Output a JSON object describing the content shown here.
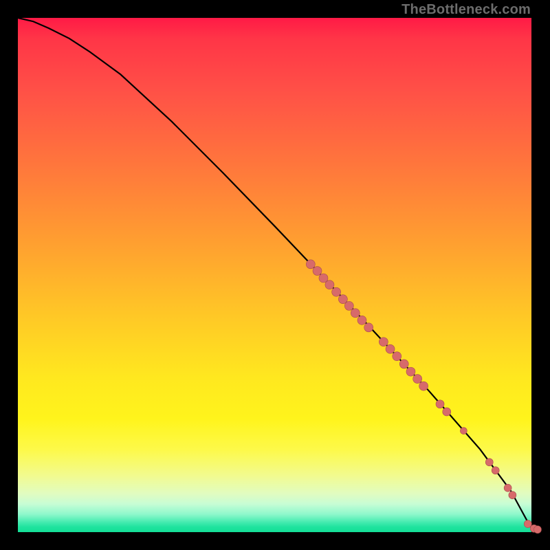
{
  "watermark": "TheBottleneck.com",
  "colors": {
    "background": "#000000",
    "curve": "#000000",
    "points": "#d76a6a",
    "points_stroke": "#a84d4d"
  },
  "chart_data": {
    "type": "scatter",
    "title": "",
    "xlabel": "",
    "ylabel": "",
    "xlim": [
      0,
      100
    ],
    "ylim": [
      0,
      100
    ],
    "curve": {
      "x": [
        0,
        3,
        6,
        10,
        14,
        20,
        30,
        40,
        50,
        60,
        70,
        80,
        90,
        96,
        99,
        100
      ],
      "y": [
        100,
        99.3,
        98.0,
        96.0,
        93.4,
        89.0,
        79.8,
        69.8,
        59.5,
        49.0,
        38.3,
        27.5,
        16.1,
        8.0,
        2.5,
        0.8
      ]
    },
    "series": [
      {
        "name": "cluster-segment",
        "x": [
          57.0,
          58.3,
          59.5,
          60.7,
          62.0,
          63.3,
          64.5,
          65.7,
          67.0,
          68.3
        ],
        "y": [
          52.1,
          50.8,
          49.4,
          48.1,
          46.7,
          45.3,
          44.0,
          42.6,
          41.2,
          39.8
        ],
        "r": 6.5
      },
      {
        "name": "cluster-mid-a",
        "x": [
          71.2,
          72.5,
          73.8
        ],
        "y": [
          37.0,
          35.6,
          34.2
        ],
        "r": 6.5
      },
      {
        "name": "cluster-mid-b",
        "x": [
          75.2,
          76.5,
          77.8,
          79.0
        ],
        "y": [
          32.7,
          31.2,
          29.8,
          28.4
        ],
        "r": 6.5
      },
      {
        "name": "cluster-low-a",
        "x": [
          82.2,
          83.5
        ],
        "y": [
          24.9,
          23.4
        ],
        "r": 6.0
      },
      {
        "name": "cluster-low-b",
        "x": [
          86.8
        ],
        "y": [
          19.7
        ],
        "r": 5.0
      },
      {
        "name": "cluster-tail-a",
        "x": [
          91.8,
          93.0
        ],
        "y": [
          13.6,
          12.0
        ],
        "r": 5.5
      },
      {
        "name": "cluster-tail-b",
        "x": [
          95.4,
          96.3
        ],
        "y": [
          8.6,
          7.2
        ],
        "r": 5.5
      },
      {
        "name": "cluster-end",
        "x": [
          99.3,
          100.5,
          101.2
        ],
        "y": [
          1.6,
          0.7,
          0.5
        ],
        "r": 5.5
      }
    ]
  }
}
